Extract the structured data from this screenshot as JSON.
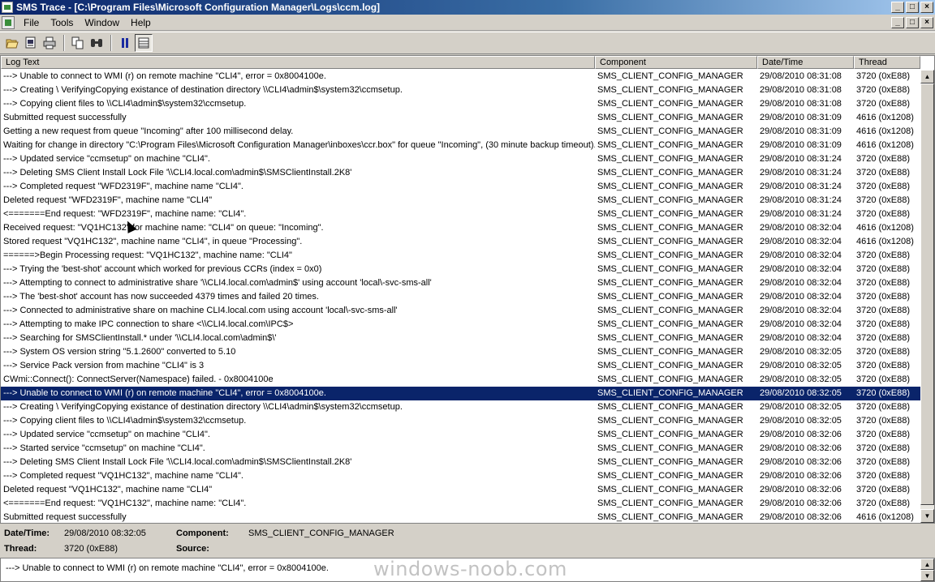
{
  "window": {
    "title": "SMS Trace - [C:\\Program Files\\Microsoft Configuration Manager\\Logs\\ccm.log]",
    "controls": [
      "_",
      "□",
      "×"
    ]
  },
  "menu": [
    "File",
    "Tools",
    "Window",
    "Help"
  ],
  "toolbar": {
    "icons": [
      "open-icon",
      "print-preview-icon",
      "print-icon",
      "copy-icon",
      "find-icon",
      "pause-icon",
      "details-icon"
    ]
  },
  "columns": [
    "Log Text",
    "Component",
    "Date/Time",
    "Thread"
  ],
  "rows": [
    {
      "text": "---> Unable to connect to WMI (r) on remote machine \"CLI4\", error = 0x8004100e.",
      "component": "SMS_CLIENT_CONFIG_MANAGER",
      "datetime": "29/08/2010 08:31:08",
      "thread": "3720 (0xE88)"
    },
    {
      "text": "---> Creating \\ VerifyingCopying existance of destination directory \\\\CLI4\\admin$\\system32\\ccmsetup.",
      "component": "SMS_CLIENT_CONFIG_MANAGER",
      "datetime": "29/08/2010 08:31:08",
      "thread": "3720 (0xE88)"
    },
    {
      "text": "---> Copying client files to \\\\CLI4\\admin$\\system32\\ccmsetup.",
      "component": "SMS_CLIENT_CONFIG_MANAGER",
      "datetime": "29/08/2010 08:31:08",
      "thread": "3720 (0xE88)"
    },
    {
      "text": "Submitted request successfully",
      "component": "SMS_CLIENT_CONFIG_MANAGER",
      "datetime": "29/08/2010 08:31:09",
      "thread": "4616 (0x1208)"
    },
    {
      "text": "Getting a new request from queue \"Incoming\" after 100 millisecond delay.",
      "component": "SMS_CLIENT_CONFIG_MANAGER",
      "datetime": "29/08/2010 08:31:09",
      "thread": "4616 (0x1208)"
    },
    {
      "text": "Waiting for change in directory \"C:\\Program Files\\Microsoft Configuration Manager\\inboxes\\ccr.box\" for queue \"Incoming\", (30 minute backup timeout).",
      "component": "SMS_CLIENT_CONFIG_MANAGER",
      "datetime": "29/08/2010 08:31:09",
      "thread": "4616 (0x1208)"
    },
    {
      "text": "---> Updated service \"ccmsetup\" on machine \"CLI4\".",
      "component": "SMS_CLIENT_CONFIG_MANAGER",
      "datetime": "29/08/2010 08:31:24",
      "thread": "3720 (0xE88)"
    },
    {
      "text": "---> Deleting SMS Client Install Lock File '\\\\CLI4.local.com\\admin$\\SMSClientInstall.2K8'",
      "component": "SMS_CLIENT_CONFIG_MANAGER",
      "datetime": "29/08/2010 08:31:24",
      "thread": "3720 (0xE88)"
    },
    {
      "text": "---> Completed request \"WFD2319F\", machine name \"CLI4\".",
      "component": "SMS_CLIENT_CONFIG_MANAGER",
      "datetime": "29/08/2010 08:31:24",
      "thread": "3720 (0xE88)"
    },
    {
      "text": "Deleted request \"WFD2319F\", machine name \"CLI4\"",
      "component": "SMS_CLIENT_CONFIG_MANAGER",
      "datetime": "29/08/2010 08:31:24",
      "thread": "3720 (0xE88)"
    },
    {
      "text": "<=======End request: \"WFD2319F\", machine name: \"CLI4\".",
      "component": "SMS_CLIENT_CONFIG_MANAGER",
      "datetime": "29/08/2010 08:31:24",
      "thread": "3720 (0xE88)"
    },
    {
      "text": "Received request: \"VQ1HC132\" for machine name: \"CLI4\" on queue: \"Incoming\".",
      "component": "SMS_CLIENT_CONFIG_MANAGER",
      "datetime": "29/08/2010 08:32:04",
      "thread": "4616 (0x1208)"
    },
    {
      "text": "Stored request \"VQ1HC132\", machine name \"CLI4\", in queue \"Processing\".",
      "component": "SMS_CLIENT_CONFIG_MANAGER",
      "datetime": "29/08/2010 08:32:04",
      "thread": "4616 (0x1208)"
    },
    {
      "text": "======>Begin Processing request: \"VQ1HC132\", machine name: \"CLI4\"",
      "component": "SMS_CLIENT_CONFIG_MANAGER",
      "datetime": "29/08/2010 08:32:04",
      "thread": "3720 (0xE88)"
    },
    {
      "text": "---> Trying the 'best-shot' account which worked for previous CCRs (index = 0x0)",
      "component": "SMS_CLIENT_CONFIG_MANAGER",
      "datetime": "29/08/2010 08:32:04",
      "thread": "3720 (0xE88)"
    },
    {
      "text": "---> Attempting to connect to administrative share '\\\\CLI4.local.com\\admin$' using account 'local\\-svc-sms-all'",
      "component": "SMS_CLIENT_CONFIG_MANAGER",
      "datetime": "29/08/2010 08:32:04",
      "thread": "3720 (0xE88)"
    },
    {
      "text": "---> The 'best-shot' account has now succeeded 4379 times and failed 20 times.",
      "component": "SMS_CLIENT_CONFIG_MANAGER",
      "datetime": "29/08/2010 08:32:04",
      "thread": "3720 (0xE88)"
    },
    {
      "text": "---> Connected to administrative share on machine CLI4.local.com using account 'local\\-svc-sms-all'",
      "component": "SMS_CLIENT_CONFIG_MANAGER",
      "datetime": "29/08/2010 08:32:04",
      "thread": "3720 (0xE88)"
    },
    {
      "text": "---> Attempting to make IPC connection to share <\\\\CLI4.local.com\\IPC$>",
      "component": "SMS_CLIENT_CONFIG_MANAGER",
      "datetime": "29/08/2010 08:32:04",
      "thread": "3720 (0xE88)"
    },
    {
      "text": "---> Searching for SMSClientInstall.* under '\\\\CLI4.local.com\\admin$\\'",
      "component": "SMS_CLIENT_CONFIG_MANAGER",
      "datetime": "29/08/2010 08:32:04",
      "thread": "3720 (0xE88)"
    },
    {
      "text": "---> System OS version string \"5.1.2600\" converted to 5.10",
      "component": "SMS_CLIENT_CONFIG_MANAGER",
      "datetime": "29/08/2010 08:32:05",
      "thread": "3720 (0xE88)"
    },
    {
      "text": "---> Service Pack version from machine \"CLI4\" is 3",
      "component": "SMS_CLIENT_CONFIG_MANAGER",
      "datetime": "29/08/2010 08:32:05",
      "thread": "3720 (0xE88)"
    },
    {
      "text": "CWmi::Connect(): ConnectServer(Namespace) failed. - 0x8004100e",
      "component": "SMS_CLIENT_CONFIG_MANAGER",
      "datetime": "29/08/2010 08:32:05",
      "thread": "3720 (0xE88)"
    },
    {
      "text": "---> Unable to connect to WMI (r) on remote machine \"CLI4\", error = 0x8004100e.",
      "component": "SMS_CLIENT_CONFIG_MANAGER",
      "datetime": "29/08/2010 08:32:05",
      "thread": "3720 (0xE88)",
      "selected": true
    },
    {
      "text": "---> Creating \\ VerifyingCopying existance of destination directory \\\\CLI4\\admin$\\system32\\ccmsetup.",
      "component": "SMS_CLIENT_CONFIG_MANAGER",
      "datetime": "29/08/2010 08:32:05",
      "thread": "3720 (0xE88)"
    },
    {
      "text": "---> Copying client files to \\\\CLI4\\admin$\\system32\\ccmsetup.",
      "component": "SMS_CLIENT_CONFIG_MANAGER",
      "datetime": "29/08/2010 08:32:05",
      "thread": "3720 (0xE88)"
    },
    {
      "text": "---> Updated service \"ccmsetup\" on machine \"CLI4\".",
      "component": "SMS_CLIENT_CONFIG_MANAGER",
      "datetime": "29/08/2010 08:32:06",
      "thread": "3720 (0xE88)"
    },
    {
      "text": "---> Started service \"ccmsetup\" on machine \"CLI4\".",
      "component": "SMS_CLIENT_CONFIG_MANAGER",
      "datetime": "29/08/2010 08:32:06",
      "thread": "3720 (0xE88)"
    },
    {
      "text": "---> Deleting SMS Client Install Lock File '\\\\CLI4.local.com\\admin$\\SMSClientInstall.2K8'",
      "component": "SMS_CLIENT_CONFIG_MANAGER",
      "datetime": "29/08/2010 08:32:06",
      "thread": "3720 (0xE88)"
    },
    {
      "text": "---> Completed request \"VQ1HC132\", machine name \"CLI4\".",
      "component": "SMS_CLIENT_CONFIG_MANAGER",
      "datetime": "29/08/2010 08:32:06",
      "thread": "3720 (0xE88)"
    },
    {
      "text": "Deleted request \"VQ1HC132\", machine name \"CLI4\"",
      "component": "SMS_CLIENT_CONFIG_MANAGER",
      "datetime": "29/08/2010 08:32:06",
      "thread": "3720 (0xE88)"
    },
    {
      "text": "<=======End request: \"VQ1HC132\", machine name: \"CLI4\".",
      "component": "SMS_CLIENT_CONFIG_MANAGER",
      "datetime": "29/08/2010 08:32:06",
      "thread": "3720 (0xE88)"
    },
    {
      "text": "Submitted request successfully",
      "component": "SMS_CLIENT_CONFIG_MANAGER",
      "datetime": "29/08/2010 08:32:06",
      "thread": "4616 (0x1208)"
    }
  ],
  "details": {
    "datetime_label": "Date/Time:",
    "datetime_value": "29/08/2010 08:32:05",
    "component_label": "Component:",
    "component_value": "SMS_CLIENT_CONFIG_MANAGER",
    "thread_label": "Thread:",
    "thread_value": "3720 (0xE88)",
    "source_label": "Source:",
    "source_value": ""
  },
  "message": "---> Unable to connect to WMI (r) on remote machine \"CLI4\", error = 0x8004100e.",
  "watermark": "windows-noob.com"
}
